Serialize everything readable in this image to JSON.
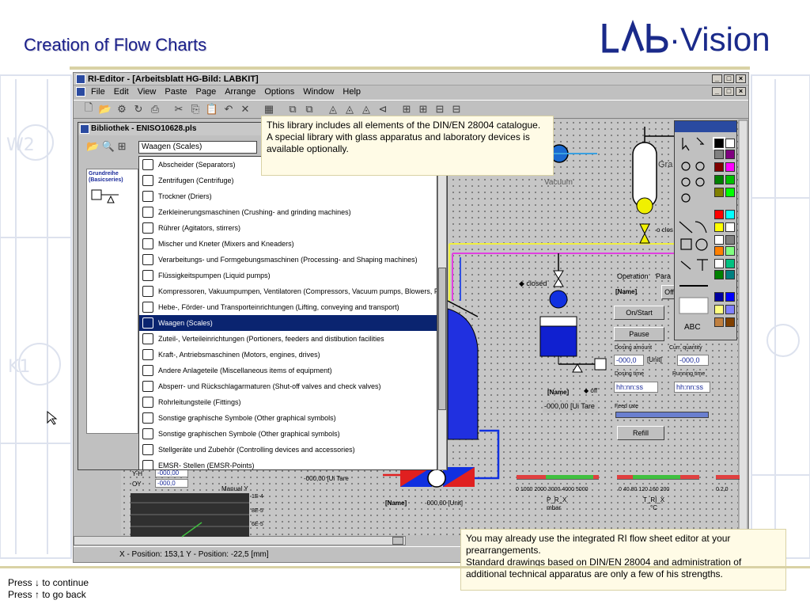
{
  "slide": {
    "title": "Creation of Flow Charts",
    "logo": "LAB-Vision",
    "nav_continue": "Press ↓ to continue",
    "nav_back": "Press ↑ to go back"
  },
  "notes": {
    "library": "This library includes all elements of the DIN/EN 28004 catalogue.\nA special library with glass apparatus and laboratory devices is available optionally.",
    "editor": "You may already use the integrated RI flow sheet editor at your prearrangements.\nStandard drawings based on DIN/EN 28004 and administration of additional technical apparatus are only a few of his strengths."
  },
  "app": {
    "title": "RI-Editor - [Arbeitsblatt HG-Bild: LABKIT]",
    "menu": [
      "File",
      "Edit",
      "View",
      "Paste",
      "Page",
      "Arrange",
      "Options",
      "Window",
      "Help"
    ],
    "status": "X - Position:  153,1    Y - Position:  -22,5     [mm]"
  },
  "library": {
    "title": "Bibliothek - ENISO10628.pls",
    "combo_value": "Waagen (Scales)",
    "panel_header": "Grundreihe (Basicseries)",
    "items": [
      "Abscheider (Separators)",
      "Zentrifugen (Centrifuge)",
      "Trockner (Driers)",
      "Zerkleinerungsmaschinen (Crushing- and grinding machines)",
      "Rührer (Agitators, stirrers)",
      "Mischer und Kneter (Mixers and Kneaders)",
      "Verarbeitungs- und Formgebungsmaschinen (Processing- and Shaping machines)",
      "Flüssigkeitspumpen (Liquid pumps)",
      "Kompressoren, Vakuumpumpen, Ventilatoren (Compressors, Vacuum pumps, Blowers, Fa",
      "Hebe-, Förder- und Transporteinrichtungen (Lifting, conveying and transport)",
      "Waagen (Scales)",
      "Zuteil-, Verteileinrichtungen (Portioners, feeders and distibution facilities",
      "Kraft-, Antriebsmaschinen (Motors, engines, drives)",
      "Andere Anlageteile (Miscellaneous items of equipment)",
      "Absperr- und Rückschlagarmaturen (Shut-off valves and check valves)",
      "Rohrleitungsteile (Fittings)",
      "Sonstige graphische Symbole (Other graphical symbols)",
      "Sonstige graphischen Symbole (Other graphical symbols)",
      "Stellgeräte und Zubehör (Controlling devices and accessories)",
      "EMSR- Stellen (EMSR-Points)"
    ],
    "selected_index": 10
  },
  "process": {
    "vacuum": "Vacuum",
    "closed": "closed",
    "operation_tab": "Operation",
    "para_tab": "Para",
    "name_label": "[Name]",
    "off": "Off",
    "on_start": "On/Start",
    "pause": "Pause",
    "dosing_amount": "Dosing amount",
    "curr_quantity": "Curr. quantity",
    "dosing_time": "Dosing time",
    "running_time": "Running time",
    "feed_rate": "Feed rate",
    "refill": "Refill",
    "value_000": "-000,0",
    "unit": "[Unit]",
    "time_fmt": "hh:nn:ss",
    "tare": "Tare",
    "tare_value": "-000,00 [Ui Tare",
    "off_small": "off",
    "name_value": "-000,00 [Unit]",
    "gauge1_ticks": "0  1000 2000 3000 4000 5000",
    "gauge1_name": "P_R_X",
    "gauge1_unit": "mbar",
    "gauge2_ticks": "0  40  80  120  160  200",
    "gauge2_name": "T_RI_X",
    "gauge2_unit": "°C",
    "gauge3_ticks": "0  2,0",
    "manual_y": "Manual Y",
    "yh": "Y-H",
    "oy": "OY",
    "val_yh": "-000,00",
    "val_oy": "-000,0",
    "e_vals": [
      "1E-4",
      "8E-5",
      "6E-5"
    ],
    "gra": "Gra",
    "closed_tag": "o clos"
  }
}
